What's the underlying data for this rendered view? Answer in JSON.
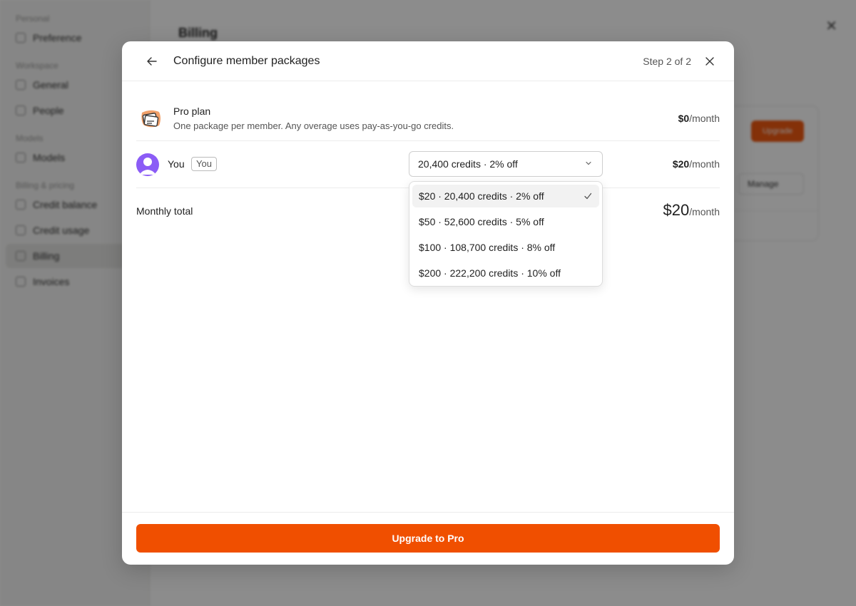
{
  "background": {
    "sidebar": {
      "sections": [
        {
          "label": "Personal",
          "items": [
            {
              "label": "Preference"
            }
          ]
        },
        {
          "label": "Workspace",
          "items": [
            {
              "label": "General"
            },
            {
              "label": "People"
            }
          ]
        },
        {
          "label": "Models",
          "items": [
            {
              "label": "Models"
            }
          ]
        },
        {
          "label": "Billing & pricing",
          "items": [
            {
              "label": "Credit balance"
            },
            {
              "label": "Credit usage"
            },
            {
              "label": "Billing",
              "active": true
            },
            {
              "label": "Invoices"
            }
          ]
        }
      ]
    },
    "page_title": "Billing",
    "upgrade_label": "Upgrade",
    "manage_label": "Manage"
  },
  "modal": {
    "title": "Configure member packages",
    "step": "Step 2 of 2",
    "plan": {
      "name": "Pro plan",
      "description": "One package per member. Any overage uses pay-as-you-go credits.",
      "price": "$0",
      "per": "/month"
    },
    "member": {
      "name": "You",
      "badge": "You",
      "selected_package": "20,400 credits · 2% off",
      "price": "$20",
      "per": "/month",
      "avatar_color": "#8b5cf6"
    },
    "dropdown_options": [
      {
        "label": "$20 · 20,400 credits · 2% off",
        "selected": true
      },
      {
        "label": "$50 · 52,600 credits · 5% off",
        "selected": false
      },
      {
        "label": "$100 · 108,700 credits · 8% off",
        "selected": false
      },
      {
        "label": "$200 · 222,200 credits · 10% off",
        "selected": false
      }
    ],
    "total": {
      "label": "Monthly total",
      "price": "$20",
      "per": "/month"
    },
    "cta_label": "Upgrade to Pro",
    "accent_color": "#f04f00"
  }
}
